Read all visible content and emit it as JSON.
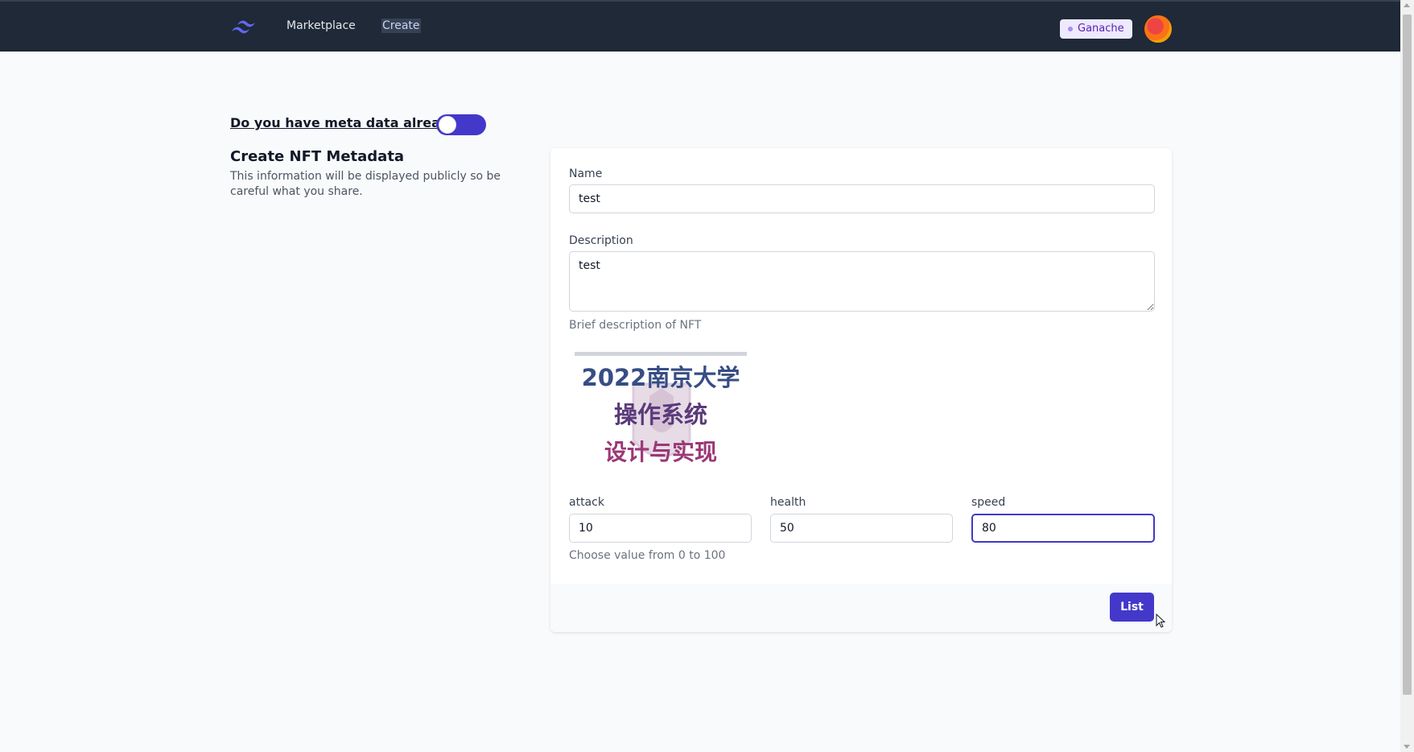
{
  "nav": {
    "links": [
      "Marketplace",
      "Create"
    ],
    "network": "Ganache"
  },
  "toggle": {
    "label": "Do you have meta data already?"
  },
  "section": {
    "title": "Create NFT Metadata",
    "subtitle": "This information will be displayed publicly so be careful what you share."
  },
  "form": {
    "name_label": "Name",
    "name_value": "test",
    "description_label": "Description",
    "description_value": "test",
    "description_hint": "Brief description of NFT",
    "image_text": [
      "2022南京大学",
      "操作系统",
      "设计与实现"
    ],
    "attributes": [
      {
        "label": "attack",
        "value": "10"
      },
      {
        "label": "health",
        "value": "50"
      },
      {
        "label": "speed",
        "value": "80"
      }
    ],
    "attributes_hint": "Choose value from 0 to 100",
    "submit_label": "List"
  },
  "colors": {
    "navbar": "#1f2937",
    "accent": "#4338ca"
  }
}
